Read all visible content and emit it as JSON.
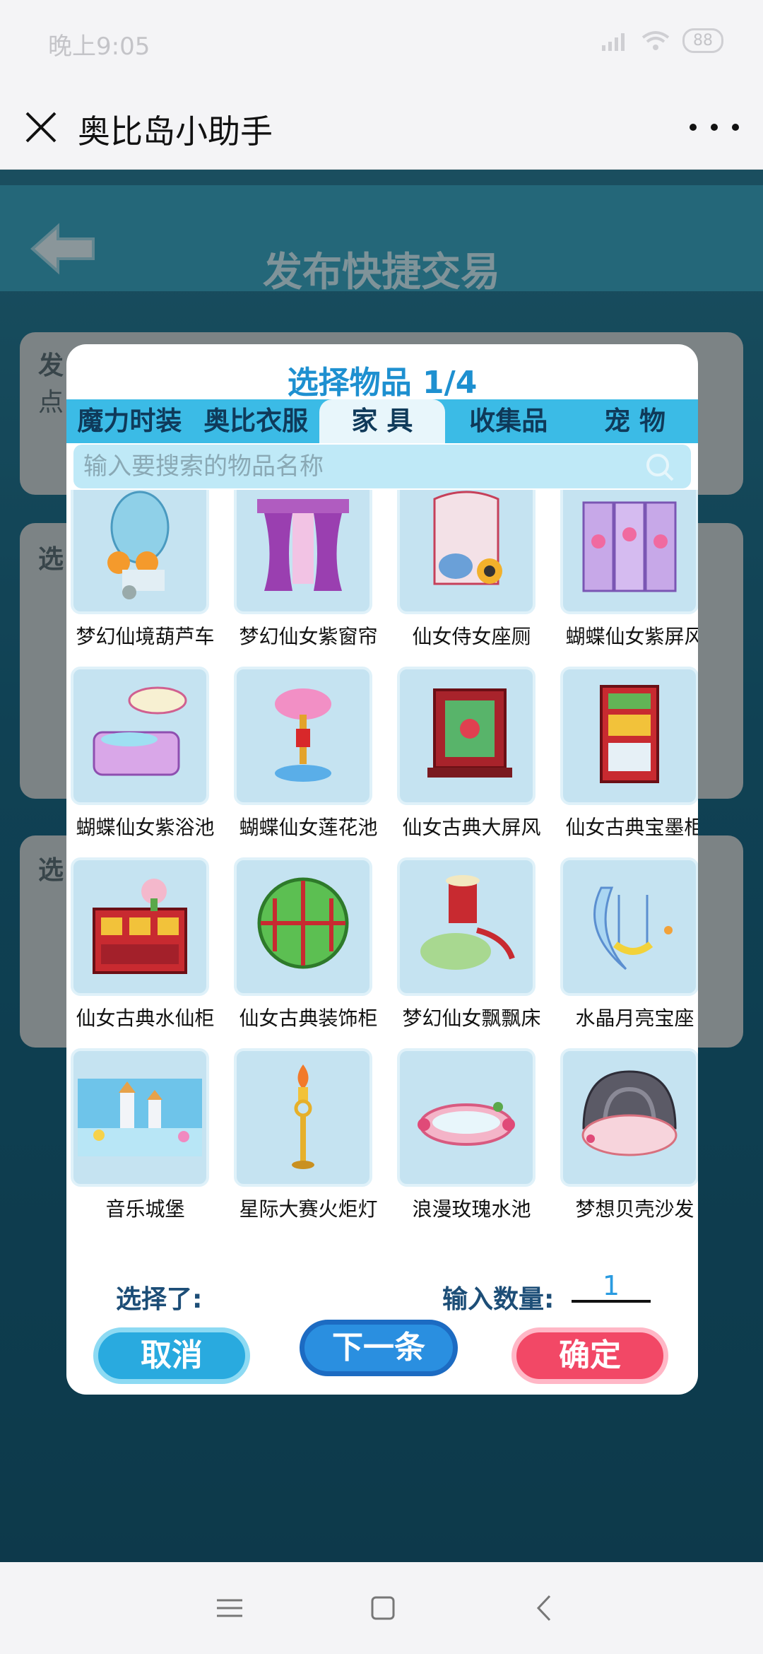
{
  "status_bar": {
    "time": "晚上9:05",
    "battery": "88"
  },
  "title_bar": {
    "title": "奥比岛小助手"
  },
  "game_bg": {
    "title": "发布快捷交易",
    "card1_label": "发",
    "card1_sub": "点",
    "card2_label": "选",
    "card3_label": "选"
  },
  "dialog": {
    "title": "选择物品 1/4",
    "tabs": [
      {
        "label": "魔力时装"
      },
      {
        "label": "奥比衣服"
      },
      {
        "label": "家 具"
      },
      {
        "label": "收集品"
      },
      {
        "label": "宠 物"
      }
    ],
    "search_placeholder": "输入要搜索的物品名称",
    "items": [
      {
        "name": "梦幻仙境葫芦车"
      },
      {
        "name": "梦幻仙女紫窗帘"
      },
      {
        "name": "仙女侍女座厕"
      },
      {
        "name": "蝴蝶仙女紫屏风"
      },
      {
        "name": "蝴蝶仙女紫浴池"
      },
      {
        "name": "蝴蝶仙女莲花池"
      },
      {
        "name": "仙女古典大屏风"
      },
      {
        "name": "仙女古典宝墨柜"
      },
      {
        "name": "仙女古典水仙柜"
      },
      {
        "name": "仙女古典装饰柜"
      },
      {
        "name": "梦幻仙女飘飘床"
      },
      {
        "name": "水晶月亮宝座"
      },
      {
        "name": "音乐城堡"
      },
      {
        "name": "星际大赛火炬灯"
      },
      {
        "name": "浪漫玫瑰水池"
      },
      {
        "name": "梦想贝壳沙发"
      }
    ],
    "selected_label": "选择了:",
    "quantity_label": "输入数量:",
    "quantity_value": "1",
    "cancel_label": "取消",
    "next_label": "下一条",
    "confirm_label": "确定"
  }
}
